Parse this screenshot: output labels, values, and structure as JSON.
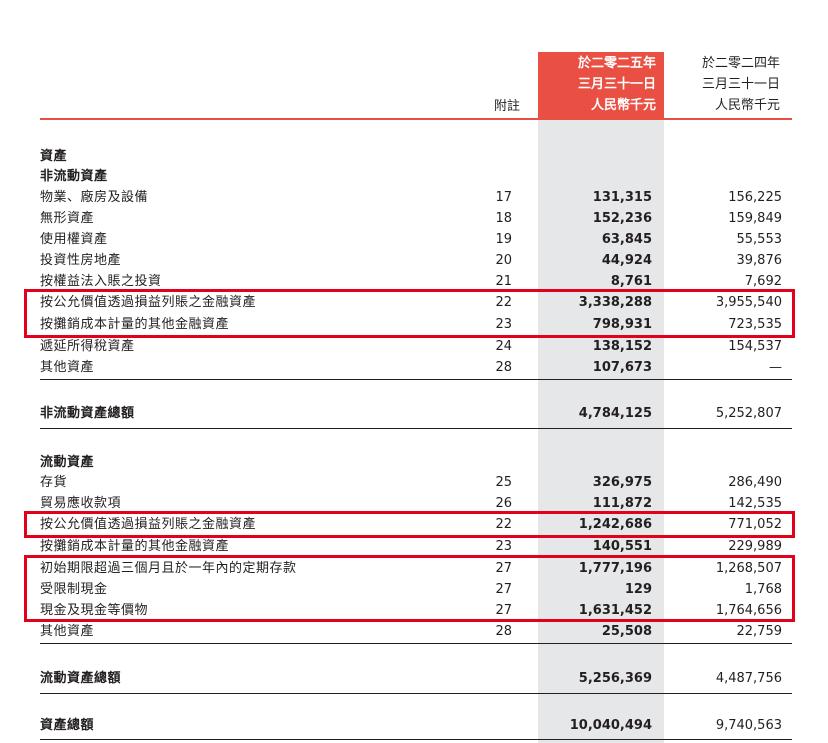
{
  "header": {
    "note_label": "附註",
    "current_period": [
      "於二零二五年",
      "三月三十一日",
      "人民幣千元"
    ],
    "prior_period": [
      "於二零二四年",
      "三月三十一日",
      "人民幣千元"
    ]
  },
  "sections": {
    "assets_title": "資產",
    "non_current_title": "非流動資產",
    "current_title": "流動資產"
  },
  "non_current_items": [
    {
      "label": "物業、廠房及設備",
      "note": "17",
      "current": "131,315",
      "prior": "156,225"
    },
    {
      "label": "無形資產",
      "note": "18",
      "current": "152,236",
      "prior": "159,849"
    },
    {
      "label": "使用權資產",
      "note": "19",
      "current": "63,845",
      "prior": "55,553"
    },
    {
      "label": "投資性房地產",
      "note": "20",
      "current": "44,924",
      "prior": "39,876"
    },
    {
      "label": "按權益法入賬之投資",
      "note": "21",
      "current": "8,761",
      "prior": "7,692"
    },
    {
      "label": "按公允價值透過損益列賬之金融資產",
      "note": "22",
      "current": "3,338,288",
      "prior": "3,955,540"
    },
    {
      "label": "按攤銷成本計量的其他金融資產",
      "note": "23",
      "current": "798,931",
      "prior": "723,535"
    },
    {
      "label": "遞延所得稅資產",
      "note": "24",
      "current": "138,152",
      "prior": "154,537"
    },
    {
      "label": "其他資產",
      "note": "28",
      "current": "107,673",
      "prior": "—"
    }
  ],
  "non_current_total": {
    "label": "非流動資產總額",
    "current": "4,784,125",
    "prior": "5,252,807"
  },
  "current_items": [
    {
      "label": "存貨",
      "note": "25",
      "current": "326,975",
      "prior": "286,490"
    },
    {
      "label": "貿易應收款項",
      "note": "26",
      "current": "111,872",
      "prior": "142,535"
    },
    {
      "label": "按公允價值透過損益列賬之金融資產",
      "note": "22",
      "current": "1,242,686",
      "prior": "771,052"
    },
    {
      "label": "按攤銷成本計量的其他金融資產",
      "note": "23",
      "current": "140,551",
      "prior": "229,989"
    },
    {
      "label": "初始期限超過三個月且於一年內的定期存款",
      "note": "27",
      "current": "1,777,196",
      "prior": "1,268,507"
    },
    {
      "label": "受限制現金",
      "note": "27",
      "current": "129",
      "prior": "1,768"
    },
    {
      "label": "現金及現金等價物",
      "note": "27",
      "current": "1,631,452",
      "prior": "1,764,656"
    },
    {
      "label": "其他資產",
      "note": "28",
      "current": "25,508",
      "prior": "22,759"
    }
  ],
  "current_total": {
    "label": "流動資產總額",
    "current": "5,256,369",
    "prior": "4,487,756"
  },
  "total_assets": {
    "label": "資產總額",
    "current": "10,040,494",
    "prior": "9,740,563"
  },
  "highlight_color": "#e2001a",
  "accent_color": "#e94f42"
}
